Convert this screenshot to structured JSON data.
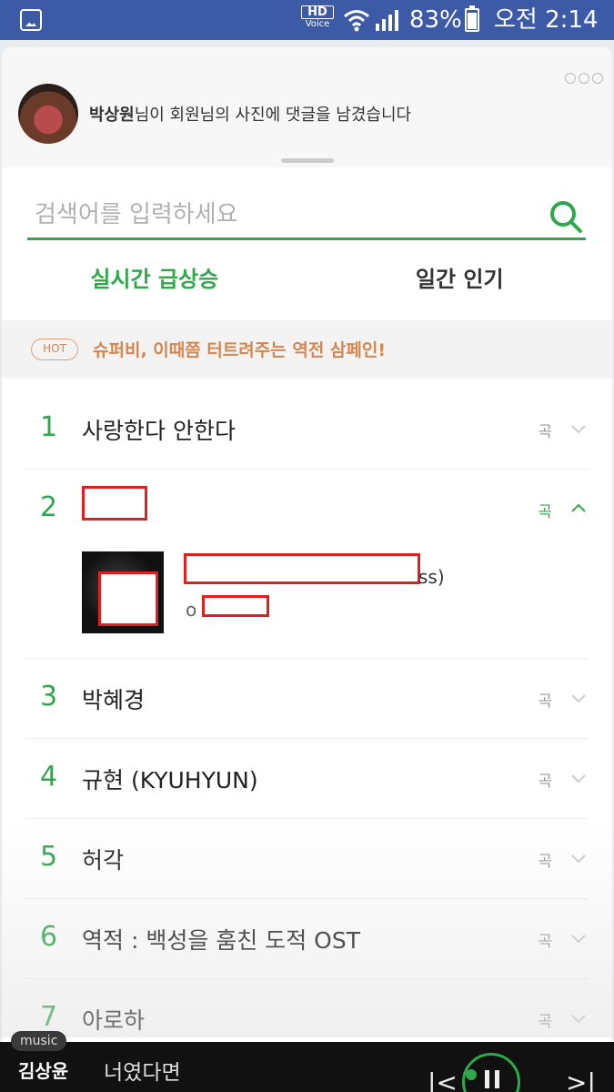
{
  "status_bar": {
    "hd_top": "HD",
    "hd_bottom": "Voice",
    "battery": "83%",
    "time": "오전 2:14",
    "icons": [
      "gallery-icon",
      "wifi-icon",
      "signal-icon",
      "battery-icon"
    ]
  },
  "notification": {
    "name": "박상원",
    "message": "님이 회원님의 사진에 댓글을 남겼습니다"
  },
  "search": {
    "placeholder": "검색어를 입력하세요"
  },
  "tabs": [
    {
      "label": "실시간 급상승",
      "active": true
    },
    {
      "label": "일간 인기",
      "active": false
    }
  ],
  "hot": {
    "badge": "HOT",
    "text": "슈퍼비, 이때쯤 터트려주는 역전 삼페인!"
  },
  "rankings": [
    {
      "rank": "1",
      "title": "사랑한다 안한다",
      "type": "곡"
    },
    {
      "rank": "2",
      "title": "",
      "type": "곡",
      "expanded": true,
      "expand_suffix": "ss)",
      "expand_prefix": "o"
    },
    {
      "rank": "3",
      "title": "박혜경",
      "type": "곡"
    },
    {
      "rank": "4",
      "title": "규현 (KYUHYUN)",
      "type": "곡"
    },
    {
      "rank": "5",
      "title": "허각",
      "type": "곡"
    },
    {
      "rank": "6",
      "title": "역적 : 백성을 훔친 도적 OST",
      "type": "곡"
    },
    {
      "rank": "7",
      "title": "아로하",
      "type": "곡"
    }
  ],
  "player": {
    "tag": "music",
    "artist": "김상윤",
    "song": "너였다면",
    "prev": "|<",
    "next": ">|"
  },
  "colors": {
    "accent": "#2ea84a",
    "status_bar": "#3c5aa6",
    "hot": "#d4864f"
  }
}
